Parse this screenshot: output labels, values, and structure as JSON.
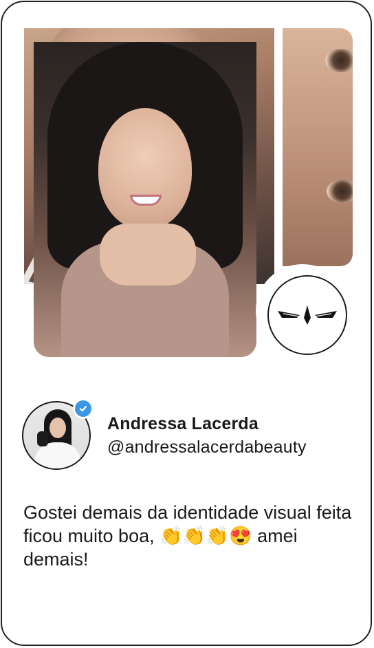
{
  "profile": {
    "name": "Andressa Lacerda",
    "handle": "@andressalacerdabeauty",
    "verified": true
  },
  "testimonial": {
    "text": "Gostei demais da identidade visual feita ficou muito boa, 👏👏👏😍 amei demais!"
  },
  "icons": {
    "logo": "brand-wings-logo-icon",
    "verified": "verified-check-icon"
  },
  "colors": {
    "border": "#222222",
    "verified_blue": "#3b97e8",
    "text": "#1a1a1a"
  }
}
